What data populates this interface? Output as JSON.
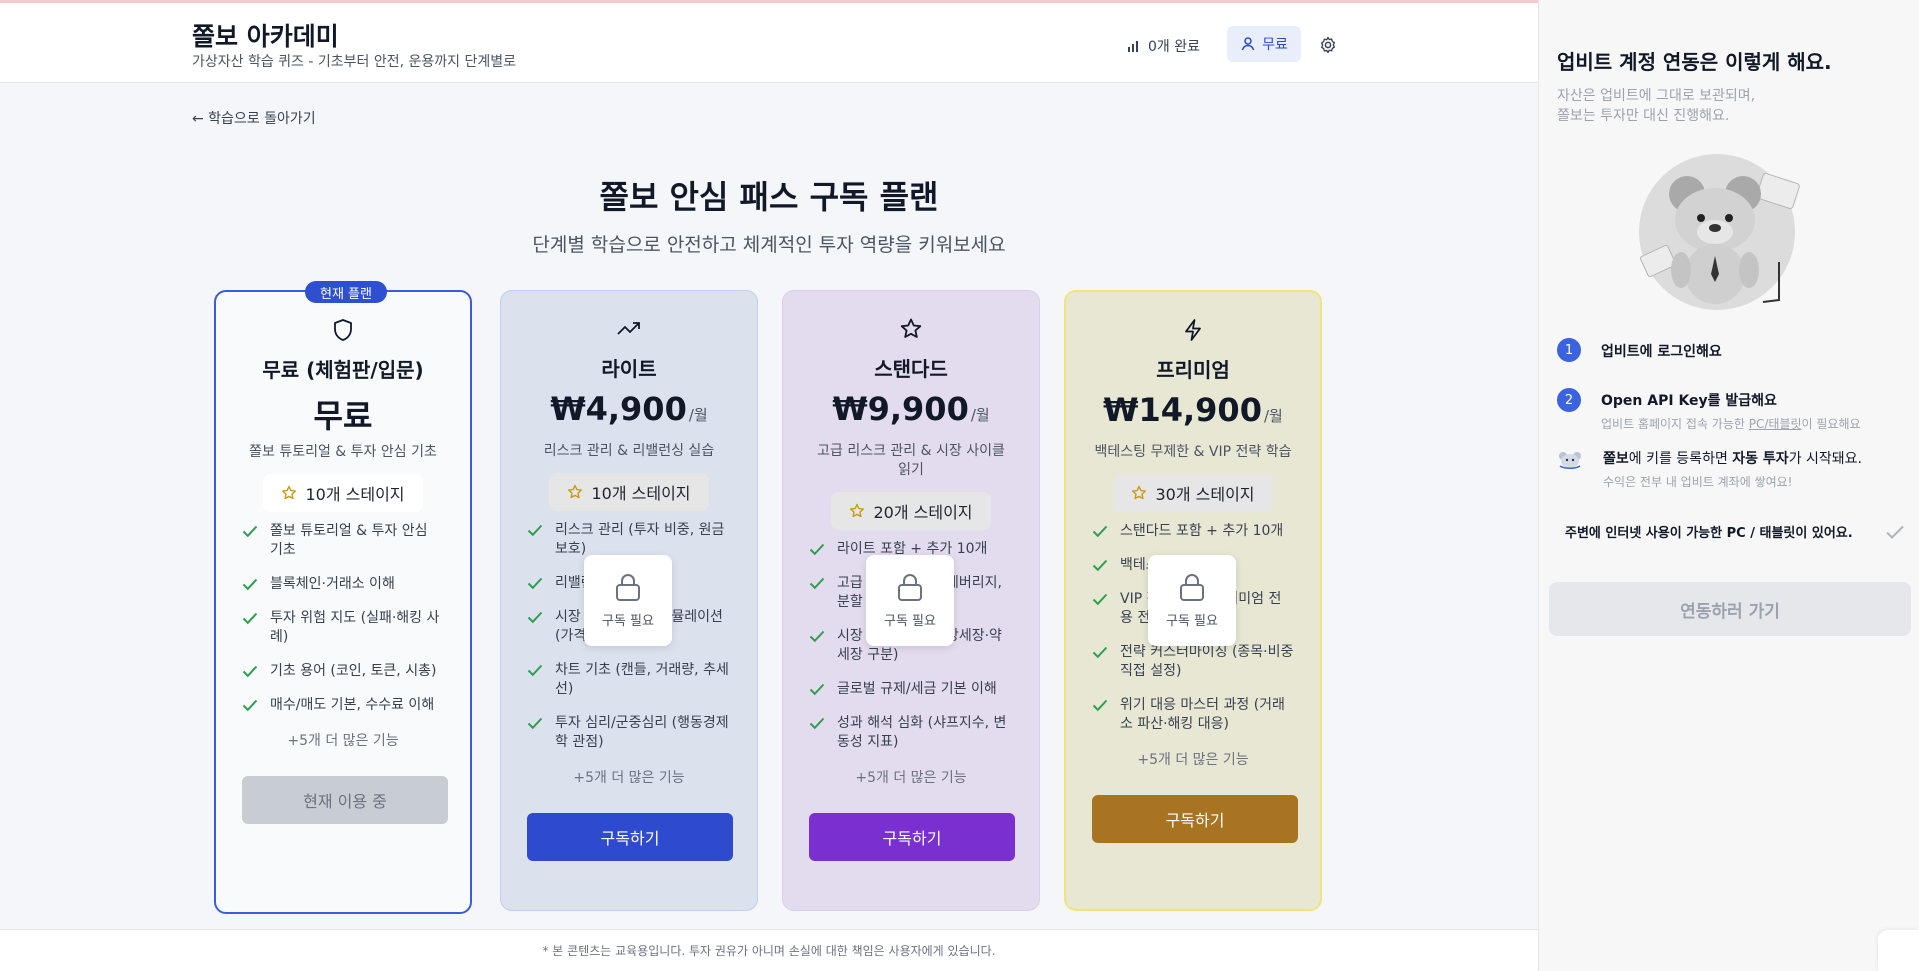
{
  "header": {
    "title": "쫄보 아카데미",
    "subtitle": "가상자산 학습 퀴즈 - 기초부터 안전, 운용까지 단계별로",
    "progress": "0개 완료",
    "plan": "무료"
  },
  "back_link": "← 학습으로 돌아가기",
  "page": {
    "title": "쫄보 안심 패스 구독 플랜",
    "subtitle": "단계별 학습으로 안전하고 체계적인 투자 역량을 키워보세요"
  },
  "current_badge": "현재 플랜",
  "plans": [
    {
      "name": "무료 (체험판/입문)",
      "price": "무료",
      "unit": "",
      "desc": "쫄보 튜토리얼 & 투자 안심 기초",
      "stages": "10개 스테이지",
      "features": [
        "쫄보 튜토리얼 & 투자 안심 기초",
        "블록체인·거래소 이해",
        "투자 위험 지도 (실패·해킹 사례)",
        "기초 용어 (코인, 토큰, 시총)",
        "매수/매도 기본, 수수료 이해"
      ],
      "more": "+5개 더 많은 기능",
      "cta": "현재 이용 중"
    },
    {
      "name": "라이트",
      "price": "₩4,900",
      "unit": "/월",
      "desc": "리스크 관리 & 리밸런싱 실습",
      "stages": "10개 스테이지",
      "features": [
        "리스크 관리 (투자 비중, 원금 보호)",
        "리밸런싱 실습",
        "시장 이벤트 대응 시뮬레이션 (가격 폭락 대응)",
        "차트 기초 (캔들, 거래량, 추세선)",
        "투자 심리/군중심리 (행동경제학 관점)"
      ],
      "more": "+5개 더 많은 기능",
      "cta": "구독하기"
    },
    {
      "name": "스탠다드",
      "price": "₩9,900",
      "unit": "/월",
      "desc": "고급 리스크 관리 & 시장 사이클 읽기",
      "stages": "20개 스테이지",
      "features": [
        "라이트 포함 + 추가 10개",
        "고급 리스크 관리 (레버리지, 분할 매수)",
        "시장 사이클 읽기 (강세장·약세장 구분)",
        "글로벌 규제/세금 기본 이해",
        "성과 해석 심화 (샤프지수, 변동성 지표)"
      ],
      "more": "+5개 더 많은 기능",
      "cta": "구독하기"
    },
    {
      "name": "프리미엄",
      "price": "₩14,900",
      "unit": "/월",
      "desc": "백테스팅 무제한 & VIP 전략 학습",
      "stages": "30개 스테이지",
      "features": [
        "스탠다드 포함 + 추가 10개",
        "백테스팅 무제한",
        "VIP 전략 학습 (프리미엄 전용 전략)",
        "전략 커스터마이징 (종목·비중 직접 설정)",
        "위기 대응 마스터 과정 (거래소 파산·해킹 대응)"
      ],
      "more": "+5개 더 많은 기능",
      "cta": "구독하기"
    }
  ],
  "lock_label": "구독 필요",
  "footer": "* 본 콘텐츠는 교육용입니다. 투자 권유가 아니며 손실에 대한 책임은 사용자에게 있습니다.",
  "panel": {
    "title": "업비트 계정 연동은 이렇게 해요.",
    "sub1": "자산은 업비트에 그대로 보관되며,",
    "sub2": "쫄보는 투자만 대신 진행해요.",
    "step1": "업비트에 로그인해요",
    "step2": "Open API Key를 발급해요",
    "step2_note_a": "업비트 홈페이지 접속 가능한 ",
    "step2_note_link": "PC/태블릿",
    "step2_note_b": "이 필요해요",
    "step3_a": "쫄보",
    "step3_b": "에 키를 등록하면 ",
    "step3_c": "자동 투자",
    "step3_d": "가 시작돼요.",
    "step3_note": "수익은 전부 내 업비트 계좌에 쌓여요!",
    "check": "주변에 인터넷 사용이 가능한 PC / 태블릿이 있어요.",
    "button": "연동하러 가기"
  },
  "colors": {
    "accent": "#2f4fd1",
    "lite_button": "#2e4bd0",
    "std_button": "#7a2fd0",
    "pre_button": "#a87422",
    "check": "#2e9e4f"
  }
}
